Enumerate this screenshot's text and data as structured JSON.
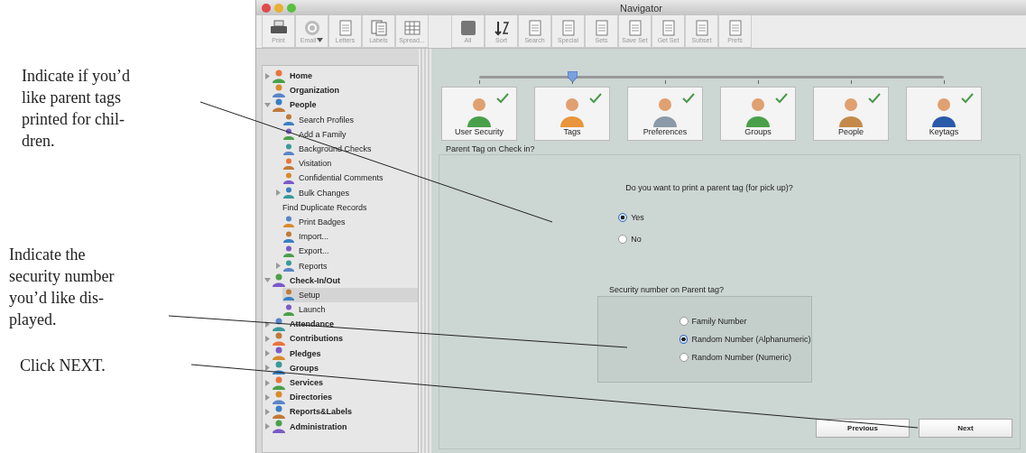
{
  "annotations": [
    {
      "text": "Indicate if you’d\nlike parent tags\nprinted for chil-\ndren."
    },
    {
      "text": "Indicate the\nsecurity number\nyou’d like dis-\nplayed."
    },
    {
      "text": "Click NEXT."
    }
  ],
  "window": {
    "title": "Navigator"
  },
  "toolbar": {
    "groups": [
      [
        {
          "label": "Print"
        },
        {
          "label": "Email",
          "dropdown": true
        },
        {
          "label": "Letters"
        },
        {
          "label": "Labels"
        },
        {
          "label": "Spread..."
        }
      ],
      [
        {
          "label": "All"
        },
        {
          "label": "Sort"
        },
        {
          "label": "Search"
        },
        {
          "label": "Special"
        },
        {
          "label": "Sets"
        },
        {
          "label": "Save Set"
        },
        {
          "label": "Get Set"
        },
        {
          "label": "Subset"
        },
        {
          "label": "Prefs"
        }
      ]
    ]
  },
  "sidebar": {
    "items": [
      {
        "label": "Home",
        "expanded": false,
        "selected": false
      },
      {
        "label": "Organization",
        "selected": false
      },
      {
        "label": "People",
        "expanded": true,
        "selected": false,
        "children": [
          {
            "label": "Search Profiles",
            "selected": false
          },
          {
            "label": "Add a Family",
            "selected": false
          },
          {
            "label": "Background Checks",
            "selected": false
          },
          {
            "label": "Visitation",
            "selected": false
          },
          {
            "label": "Confidential Comments",
            "selected": false
          },
          {
            "label": "Bulk Changes",
            "expanded": false,
            "selected": false
          },
          {
            "label": "Find Duplicate Records",
            "no_icon": true,
            "selected": false
          },
          {
            "label": "Print Badges",
            "selected": false
          },
          {
            "label": "Import...",
            "selected": false
          },
          {
            "label": "Export...",
            "selected": false
          },
          {
            "label": "Reports",
            "expanded": false,
            "selected": false
          }
        ]
      },
      {
        "label": "Check-In/Out",
        "expanded": true,
        "selected": false,
        "children": [
          {
            "label": "Setup",
            "selected": true
          },
          {
            "label": "Launch",
            "selected": false
          }
        ]
      },
      {
        "label": "Attendance",
        "expanded": false,
        "selected": false
      },
      {
        "label": "Contributions",
        "expanded": false,
        "selected": false
      },
      {
        "label": "Pledges",
        "expanded": false,
        "selected": false
      },
      {
        "label": "Groups",
        "expanded": false,
        "selected": false
      },
      {
        "label": "Services",
        "expanded": false,
        "selected": false
      },
      {
        "label": "Directories",
        "expanded": false,
        "selected": false
      },
      {
        "label": "Reports&Labels",
        "expanded": false,
        "selected": false
      },
      {
        "label": "Administration",
        "expanded": false,
        "selected": false
      }
    ]
  },
  "stepper": {
    "level": 0.2
  },
  "steps": [
    {
      "label": "User Security",
      "done": true
    },
    {
      "label": "Tags",
      "done": true
    },
    {
      "label": "Preferences",
      "done": true
    },
    {
      "label": "Groups",
      "done": true
    },
    {
      "label": "People",
      "done": true
    },
    {
      "label": "Keytags",
      "done": true
    }
  ],
  "form": {
    "section_title": "Parent Tag on Check in?",
    "question": {
      "text": "Do you want to print a parent tag (for pick up)?",
      "options": [
        {
          "label": "Yes",
          "selected": true
        },
        {
          "label": "No",
          "selected": false
        }
      ]
    },
    "security": {
      "title": "Security number on Parent tag?",
      "options": [
        {
          "label": "Family Number",
          "selected": false
        },
        {
          "label": "Random Number (Alphanumeric)",
          "selected": true
        },
        {
          "label": "Random Number (Numeric)",
          "selected": false
        }
      ]
    },
    "buttons": [
      {
        "label": "Previous"
      },
      {
        "label": "Next"
      }
    ]
  }
}
